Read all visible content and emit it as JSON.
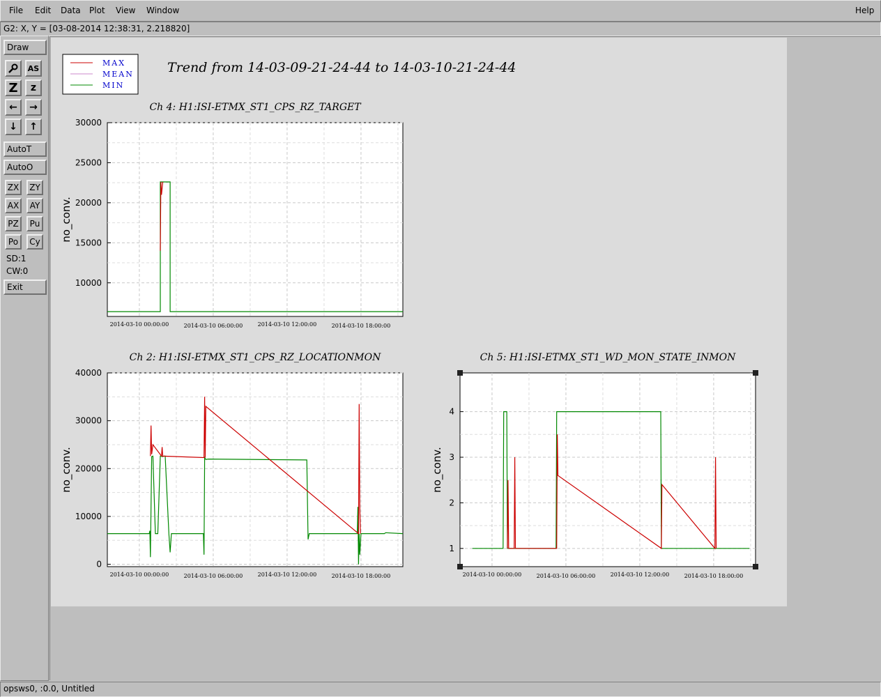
{
  "menu": {
    "items": [
      {
        "label": "File",
        "key": "F"
      },
      {
        "label": "Edit",
        "key": "E"
      },
      {
        "label": "Data",
        "key": "D"
      },
      {
        "label": "Plot",
        "key": "P"
      },
      {
        "label": "View",
        "key": "V"
      },
      {
        "label": "Window",
        "key": "W"
      }
    ],
    "help": "Help"
  },
  "coord_readout": "G2: X, Y = [03-08-2014 12:38:31, 2.218820]",
  "toolbar": {
    "draw": "Draw",
    "icon_buttons": [
      {
        "name": "magnifier-icon",
        "glyph": "🔍"
      },
      {
        "name": "text-tool-icon",
        "glyph": "AS"
      },
      {
        "name": "zoom-big-icon",
        "glyph": "Z"
      },
      {
        "name": "zoom-small-icon",
        "glyph": "z"
      },
      {
        "name": "arrow-left-icon",
        "glyph": "←"
      },
      {
        "name": "arrow-right-icon",
        "glyph": "→"
      },
      {
        "name": "arrow-down-icon",
        "glyph": "↓"
      },
      {
        "name": "arrow-up-icon",
        "glyph": "↑"
      }
    ],
    "autot": "AutoT",
    "autoo": "AutoO",
    "small_buttons": [
      "ZX",
      "ZY",
      "AX",
      "AY",
      "PZ",
      "Pu",
      "Po",
      "Cy"
    ],
    "sd": "SD:1",
    "cw": "CW:0",
    "exit": "Exit"
  },
  "status": "opsws0, :0.0, Untitled",
  "legend": {
    "entries": [
      {
        "name": "MAX",
        "color": "#cc0000"
      },
      {
        "name": "MEAN",
        "color": "#cc88cc"
      },
      {
        "name": "MIN",
        "color": "#008800"
      }
    ]
  },
  "trend_title": "Trend from 14-03-09-21-24-44 to 14-03-10-21-24-44",
  "chart_data": [
    {
      "type": "line",
      "title": "Ch 4: H1:ISI-ETMX_ST1_CPS_RZ_TARGET",
      "ylabel": "no_conv.",
      "yticks": [
        "30000",
        "25000",
        "20000",
        "15000",
        "10000"
      ],
      "ytick_values": [
        30000,
        25000,
        20000,
        15000,
        10000
      ],
      "ylim": [
        5800,
        30000
      ],
      "xlim": [
        0,
        24
      ],
      "xticks": [
        "2014-03-10 00:00:00",
        "2014-03-10 06:00:00",
        "2014-03-10 12:00:00",
        "2014-03-10 18:00:00"
      ],
      "xtick_values": [
        2.6,
        8.6,
        14.6,
        20.6
      ],
      "series": [
        {
          "name": "MIN",
          "color": "#008800",
          "x": [
            0,
            4.3,
            4.3,
            5.1,
            5.1,
            24
          ],
          "y": [
            6400,
            6400,
            22600,
            22600,
            6400,
            6400
          ]
        },
        {
          "name": "MAX",
          "color": "#cc0000",
          "x": [
            4.3,
            4.35,
            4.4,
            4.5
          ],
          "y": [
            14000,
            22600,
            21000,
            22600
          ]
        }
      ]
    },
    {
      "type": "line",
      "title": "Ch 2: H1:ISI-ETMX_ST1_CPS_RZ_LOCATIONMON",
      "ylabel": "no_conv.",
      "yticks": [
        "40000",
        "30000",
        "20000",
        "10000",
        "0"
      ],
      "ytick_values": [
        40000,
        30000,
        20000,
        10000,
        0
      ],
      "ylim": [
        -500,
        40000
      ],
      "xlim": [
        0,
        24
      ],
      "xticks": [
        "2014-03-10 00:00:00",
        "2014-03-10 06:00:00",
        "2014-03-10 12:00:00",
        "2014-03-10 18:00:00"
      ],
      "xtick_values": [
        2.6,
        8.6,
        14.6,
        20.6
      ],
      "series": [
        {
          "name": "MIN",
          "color": "#008800",
          "x": [
            0,
            3.4,
            3.45,
            3.5,
            3.6,
            3.7,
            3.9,
            4.0,
            4.1,
            4.3,
            4.35,
            4.5,
            4.6,
            4.7,
            5.0,
            5.1,
            5.2,
            5.3,
            7.8,
            7.85,
            7.9,
            8.0,
            8.2,
            16.2,
            16.3,
            16.4,
            20.3,
            20.35,
            20.4,
            20.45,
            20.5,
            20.6,
            20.7,
            22.5,
            22.6,
            24
          ],
          "y": [
            6400,
            6400,
            7000,
            1500,
            22500,
            22600,
            6400,
            6400,
            6400,
            22600,
            22600,
            22500,
            22600,
            22600,
            6400,
            2500,
            6400,
            6400,
            6400,
            2000,
            22300,
            21900,
            22000,
            21800,
            5200,
            6400,
            6400,
            12000,
            0,
            6400,
            2000,
            6400,
            6400,
            6400,
            6600,
            6400
          ]
        },
        {
          "name": "MAX",
          "color": "#cc0000",
          "x": [
            3.5,
            3.55,
            3.6,
            3.7,
            4.4,
            4.45,
            4.5,
            7.85,
            7.9,
            7.95,
            8.0,
            20.4,
            20.45,
            20.5,
            20.55
          ],
          "y": [
            22600,
            29000,
            23000,
            25000,
            22600,
            24500,
            22600,
            22300,
            35000,
            22300,
            33000,
            6400,
            33500,
            12000,
            6400
          ]
        }
      ]
    },
    {
      "type": "line",
      "title": "Ch 5: H1:ISI-ETMX_ST1_WD_MON_STATE_INMON",
      "ylabel": "no_conv.",
      "yticks": [
        "4",
        "3",
        "2",
        "1"
      ],
      "ytick_values": [
        4,
        3,
        2,
        1
      ],
      "ylim": [
        0.6,
        4.85
      ],
      "xlim": [
        0,
        24
      ],
      "xticks": [
        "2014-03-10 00:00:00",
        "2014-03-10 06:00:00",
        "2014-03-10 12:00:00",
        "2014-03-10 18:00:00"
      ],
      "xtick_values": [
        2.6,
        8.6,
        14.6,
        20.6
      ],
      "series": [
        {
          "name": "MIN",
          "color": "#008800",
          "x": [
            1,
            3.5,
            3.55,
            3.8,
            3.85,
            7.8,
            7.85,
            16.3,
            16.35,
            23.5
          ],
          "y": [
            1,
            1,
            4,
            4,
            1,
            1,
            4,
            4,
            1,
            1
          ]
        },
        {
          "name": "MAX",
          "color": "#cc0000",
          "x": [
            3.85,
            3.9,
            3.95,
            4.4,
            4.45,
            4.5,
            7.85,
            7.9,
            7.95,
            16.35,
            16.4,
            20.7,
            20.75,
            20.8
          ],
          "y": [
            1,
            2.5,
            1,
            1,
            3,
            1,
            1,
            3.5,
            2.6,
            1,
            2.4,
            1,
            3,
            1
          ]
        }
      ]
    }
  ]
}
